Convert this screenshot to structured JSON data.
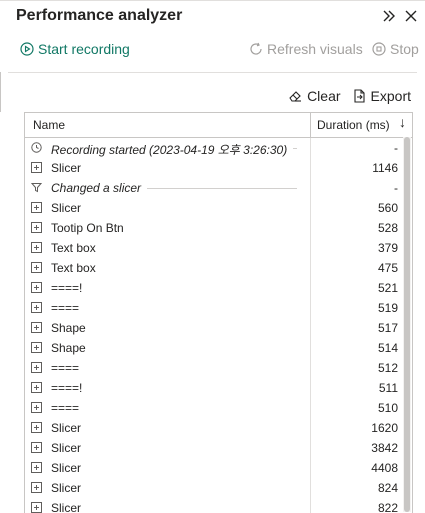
{
  "pane": {
    "title": "Performance analyzer",
    "icons": [
      "double-chevron-right-icon",
      "close-icon"
    ]
  },
  "toolbar": {
    "start_recording": "Start recording",
    "refresh_visuals": "Refresh visuals",
    "stop": "Stop"
  },
  "table_tools": {
    "clear": "Clear",
    "export": "Export"
  },
  "table": {
    "columns": [
      "Name",
      "Duration (ms)"
    ],
    "sort": "descending",
    "rows": [
      {
        "type": "marker",
        "icon": "clock-icon",
        "name": "Recording started (2023-04-19 오후 3:26:30)",
        "duration": "-"
      },
      {
        "type": "item",
        "icon": "expand-icon",
        "name": "Slicer",
        "duration": "1146"
      },
      {
        "type": "marker",
        "icon": "filter-icon",
        "name": "Changed a slicer",
        "duration": "-"
      },
      {
        "type": "item",
        "icon": "expand-icon",
        "name": "Slicer",
        "duration": "560"
      },
      {
        "type": "item",
        "icon": "expand-icon",
        "name": "Tootip On Btn",
        "duration": "528"
      },
      {
        "type": "item",
        "icon": "expand-icon",
        "name": "Text box",
        "duration": "379"
      },
      {
        "type": "item",
        "icon": "expand-icon",
        "name": "Text box",
        "duration": "475"
      },
      {
        "type": "item",
        "icon": "expand-icon",
        "name": "====!",
        "duration": "521"
      },
      {
        "type": "item",
        "icon": "expand-icon",
        "name": "====",
        "duration": "519"
      },
      {
        "type": "item",
        "icon": "expand-icon",
        "name": "Shape",
        "duration": "517"
      },
      {
        "type": "item",
        "icon": "expand-icon",
        "name": "Shape",
        "duration": "514"
      },
      {
        "type": "item",
        "icon": "expand-icon",
        "name": "====",
        "duration": "512"
      },
      {
        "type": "item",
        "icon": "expand-icon",
        "name": "====!",
        "duration": "511"
      },
      {
        "type": "item",
        "icon": "expand-icon",
        "name": "====",
        "duration": "510"
      },
      {
        "type": "item",
        "icon": "expand-icon",
        "name": "Slicer",
        "duration": "1620"
      },
      {
        "type": "item",
        "icon": "expand-icon",
        "name": "Slicer",
        "duration": "3842"
      },
      {
        "type": "item",
        "icon": "expand-icon",
        "name": "Slicer",
        "duration": "4408"
      },
      {
        "type": "item",
        "icon": "expand-icon",
        "name": "Slicer",
        "duration": "824"
      },
      {
        "type": "item",
        "icon": "expand-icon",
        "name": "Slicer",
        "duration": "822"
      }
    ]
  },
  "colors": {
    "accent": "#117865",
    "disabled": "#a19f9d",
    "text": "#252423"
  }
}
